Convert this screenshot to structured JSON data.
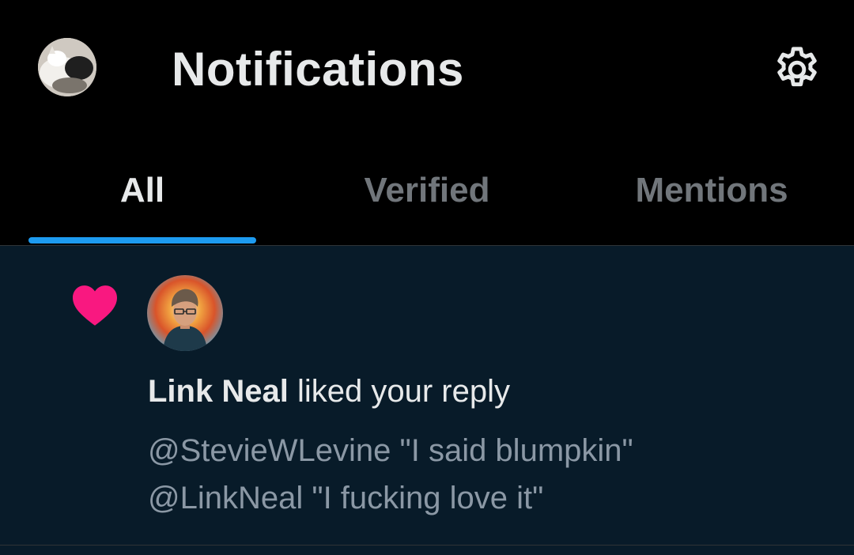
{
  "header": {
    "title": "Notifications",
    "avatar_icon": "user-avatar-cat",
    "settings_icon": "gear-icon"
  },
  "tabs": [
    {
      "label": "All",
      "active": true
    },
    {
      "label": "Verified",
      "active": false
    },
    {
      "label": "Mentions",
      "active": false
    }
  ],
  "notification": {
    "type_icon": "heart-icon",
    "icon_color": "#f91880",
    "actor_name": "Link Neal",
    "action_text": "liked your reply",
    "snippet_lines": [
      "@StevieWLevine \"I said blumpkin\"",
      "@LinkNeal \"I fucking love it\""
    ]
  },
  "colors": {
    "background": "#000000",
    "notification_bg": "#081b29",
    "accent": "#1d9bf0",
    "secondary_text": "#71767b",
    "primary_text": "#e7e9ea"
  }
}
